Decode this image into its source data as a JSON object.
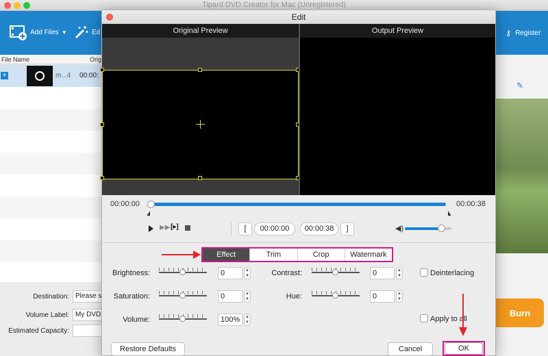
{
  "app": {
    "window_title": "Tipard DVD Creator for Mac (Unregistered)",
    "toolbar": {
      "add_files": "Add Files",
      "edit_partial": "Ed",
      "register": "Register"
    },
    "file_list": {
      "col_file_name": "File Name",
      "col_orig_partial": "Orig",
      "rows": [
        {
          "name": "m...4",
          "duration": "00:00:"
        }
      ]
    },
    "bottom": {
      "destination_label": "Destination:",
      "destination_value": "Please s",
      "volume_label": "Volume Label:",
      "volume_value": "My DVD",
      "capacity_label": "Estimated Capacity:"
    },
    "burn_label": "Burn"
  },
  "dialog": {
    "title": "Edit",
    "original_preview": "Original Preview",
    "output_preview": "Output Preview",
    "time_start": "00:00:00",
    "time_end": "00:00:38",
    "clip_start": "00:00:00",
    "clip_end": "00:00:38",
    "bracket_open": "[",
    "bracket_close": "]",
    "tabs": [
      {
        "label": "Effect",
        "active": true
      },
      {
        "label": "Trim",
        "active": false
      },
      {
        "label": "Crop",
        "active": false
      },
      {
        "label": "Watermark",
        "active": false
      }
    ],
    "brightness_label": "Brightness:",
    "brightness_value": "0",
    "contrast_label": "Contrast:",
    "contrast_value": "0",
    "saturation_label": "Saturation:",
    "saturation_value": "0",
    "hue_label": "Hue:",
    "hue_value": "0",
    "volume_label": "Volume:",
    "volume_value": "100%",
    "deinterlacing_label": "Deinterlacing",
    "apply_to_all_label": "Apply to all",
    "restore_defaults": "Restore Defaults",
    "cancel": "Cancel",
    "ok": "OK",
    "volume_level": 0.8,
    "playhead_position": 0.0
  },
  "colors": {
    "toolbar_blue": "#1f84cc",
    "timeline_blue": "#1a82d6",
    "highlight_magenta": "#d21a8a",
    "annotation_arrow": "#e8242a",
    "burn_orange": "#f39a1e"
  }
}
